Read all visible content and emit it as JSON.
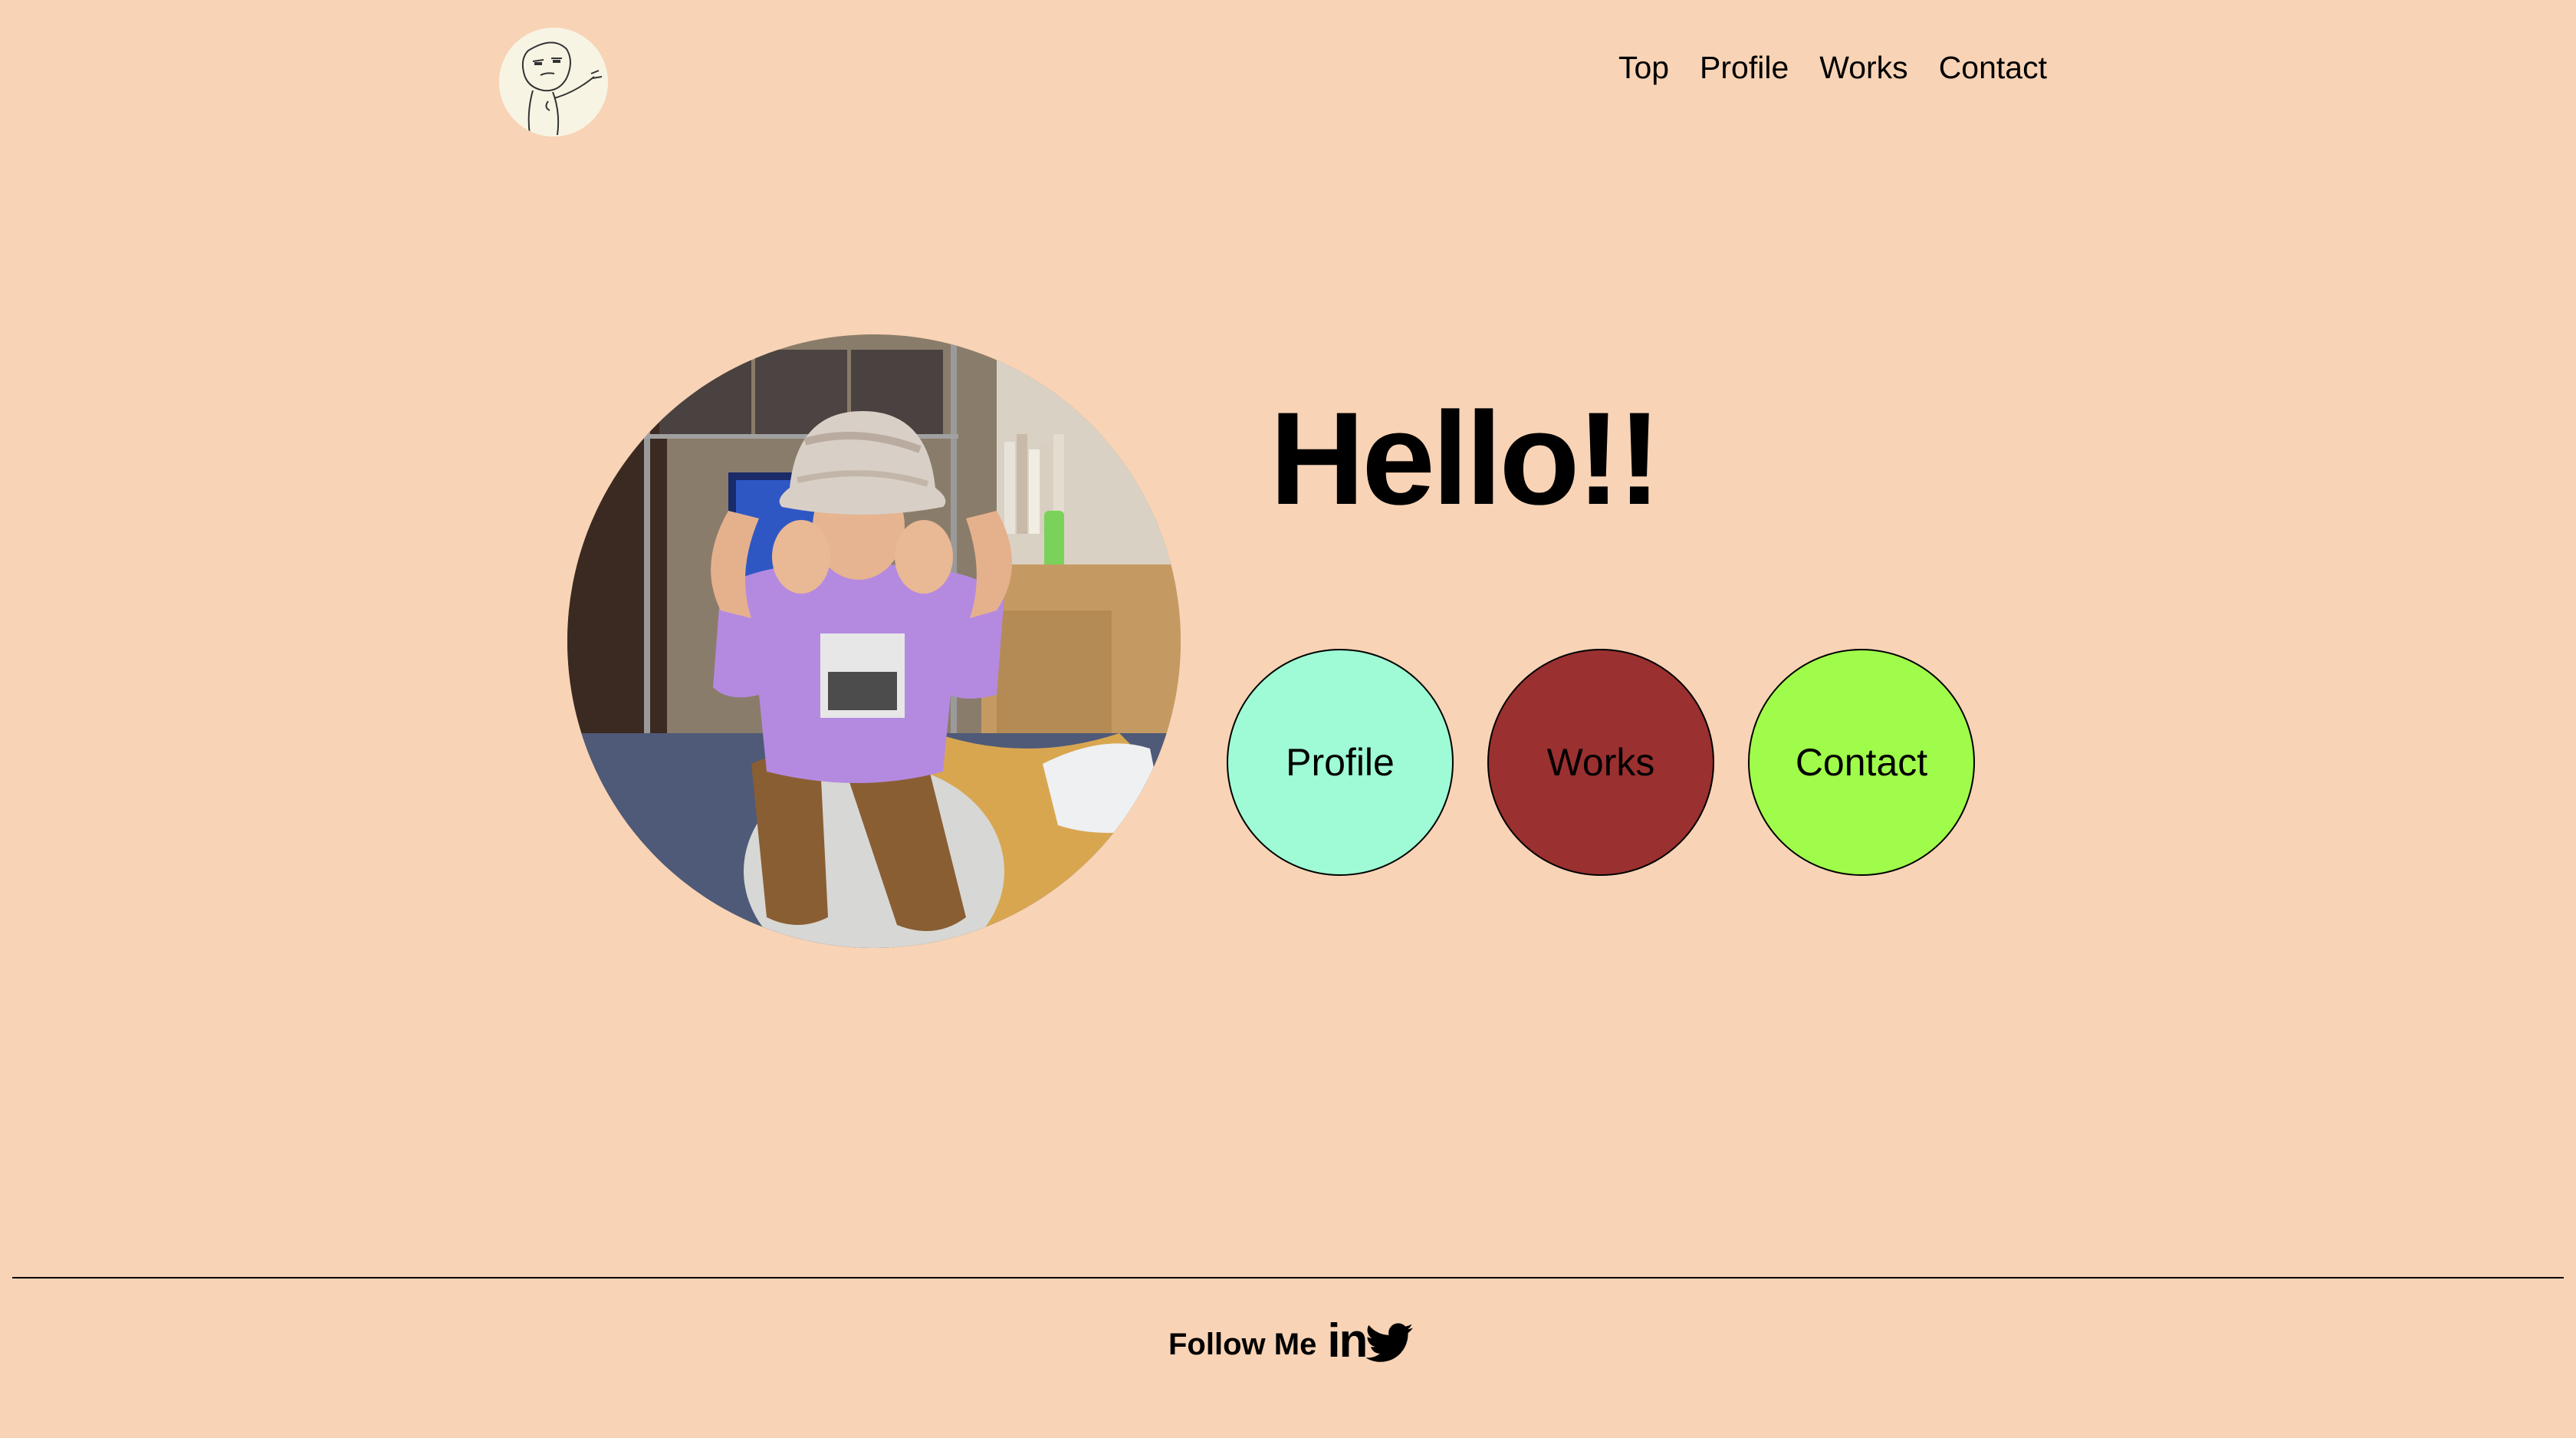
{
  "header": {
    "logo_alt": "logo",
    "nav": [
      {
        "label": "Top"
      },
      {
        "label": "Profile"
      },
      {
        "label": "Works"
      },
      {
        "label": "Contact"
      }
    ]
  },
  "hero": {
    "greeting": "Hello!!",
    "photo_alt": "profile photo",
    "buttons": [
      {
        "label": "Profile",
        "color": "#9ffbd5"
      },
      {
        "label": "Works",
        "color": "#9a302f"
      },
      {
        "label": "Contact",
        "color": "#a0fc4a"
      }
    ]
  },
  "footer": {
    "follow_label": "Follow Me",
    "sns": [
      {
        "icon": "linkedin-icon",
        "glyph": "in"
      },
      {
        "icon": "twitter-icon"
      }
    ]
  },
  "colors": {
    "background": "#f8d3b5",
    "logo_bg": "#f7f4e4"
  }
}
